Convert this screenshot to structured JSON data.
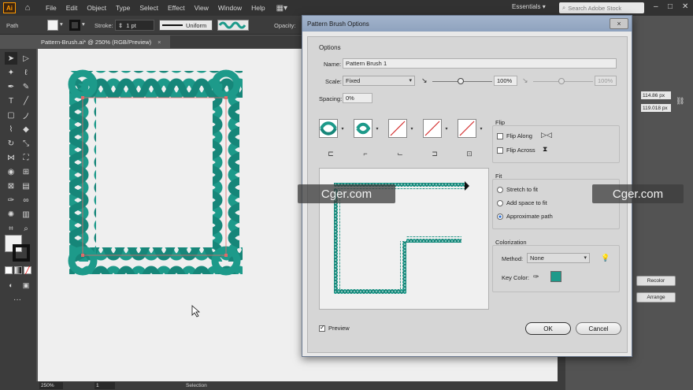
{
  "menubar": {
    "app_logo": "Ai",
    "items": [
      "File",
      "Edit",
      "Object",
      "Type",
      "Select",
      "Effect",
      "View",
      "Window",
      "Help"
    ],
    "workspace": "Essentials",
    "search_placeholder": "Search Adobe Stock"
  },
  "controlbar": {
    "selection_label": "Path",
    "stroke_label": "Stroke:",
    "stroke_weight": "1 pt",
    "stroke_profile": "Uniform",
    "opacity_label": "Opacity:"
  },
  "document_tab": {
    "title": "Pattern-Brush.ai* @ 250% (RGB/Preview)",
    "close": "×"
  },
  "statusbar": {
    "zoom": "250%",
    "artboard": "1",
    "tool": "Selection"
  },
  "right_panel": {
    "width": "114.86 px",
    "height": "119.018 px",
    "recolor": "Recolor",
    "arrange": "Arrange"
  },
  "dialog": {
    "title": "Pattern Brush Options",
    "close": "×",
    "options_header": "Options",
    "name_label": "Name:",
    "name_value": "Pattern Brush 1",
    "scale_label": "Scale:",
    "scale_value": "Fixed",
    "scale_percent": "100%",
    "scale_percent_disabled": "100%",
    "spacing_label": "Spacing:",
    "spacing_value": "0%",
    "flip_header": "Flip",
    "flip_along": "Flip Along",
    "flip_across": "Flip Across",
    "fit_header": "Fit",
    "fit_options": [
      "Stretch to fit",
      "Add space to fit",
      "Approximate path"
    ],
    "colorization_header": "Colorization",
    "method_label": "Method:",
    "method_value": "None",
    "key_color_label": "Key Color:",
    "key_color": "#1d9a8a",
    "preview_label": "Preview",
    "ok_label": "OK",
    "cancel_label": "Cancel"
  },
  "watermark": "Cger.com",
  "colors": {
    "teal": "#1d9a8a",
    "teal_dark": "#137a6d",
    "ui_dark": "#323232"
  }
}
